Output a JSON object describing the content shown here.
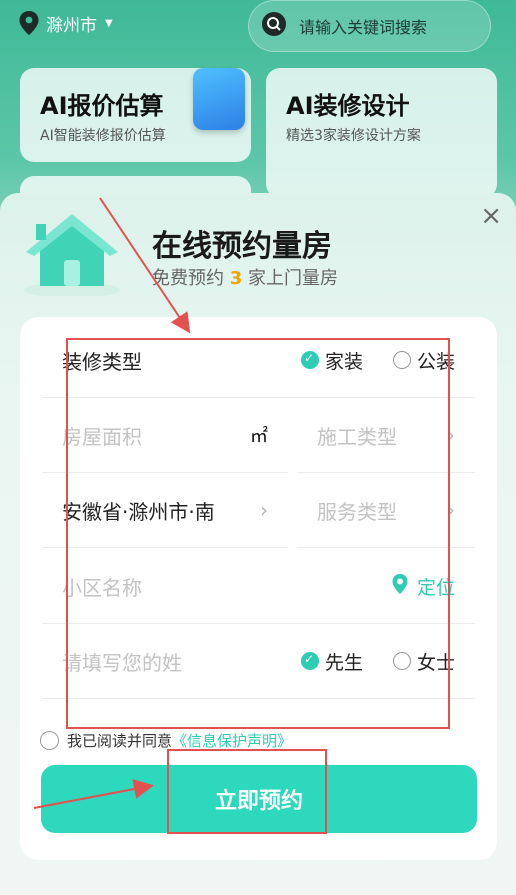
{
  "header": {
    "city": "滁州市",
    "search_placeholder": "请输入关键词搜索"
  },
  "cards": [
    {
      "title": "AI报价估算",
      "subtitle": "AI智能装修报价估算"
    },
    {
      "title": "AI装修设计",
      "subtitle": "精选3家装修设计方案"
    }
  ],
  "modal": {
    "title": "在线预约量房",
    "subtitle_prefix": "免费预约 ",
    "subtitle_count": "3",
    "subtitle_suffix": " 家上门量房",
    "close": "×"
  },
  "form": {
    "decoration_type_label": "装修类型",
    "decoration_options": [
      "家装",
      "公装"
    ],
    "area_placeholder": "房屋面积",
    "area_unit": "㎡",
    "construction_type_placeholder": "施工类型",
    "region_value": "安徽省·滁州市·南",
    "service_type_placeholder": "服务类型",
    "community_placeholder": "小区名称",
    "locate_label": "定位",
    "surname_placeholder": "请填写您的姓",
    "gender_options": [
      "先生",
      "女士"
    ],
    "agree_text": "我已阅读并同意",
    "agree_link": "《信息保护声明》",
    "submit_label": "立即预约"
  },
  "colors": {
    "accent": "#2ecdb3",
    "highlight": "#f4a300",
    "annotation": "#e2504f"
  }
}
